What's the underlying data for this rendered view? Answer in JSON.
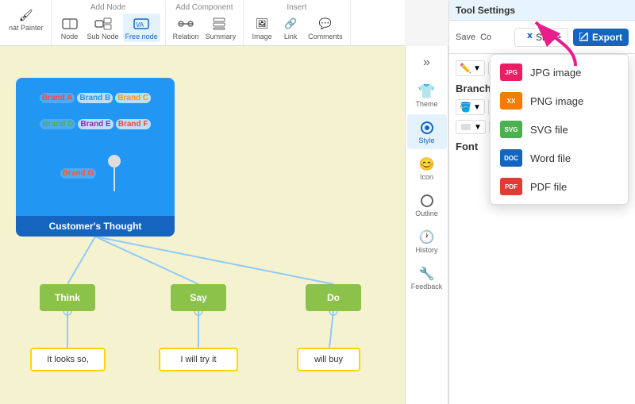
{
  "toolbar": {
    "title": "Tool Settings",
    "groups": [
      {
        "label": "nat Painter",
        "items": [
          {
            "icon": "🖌️",
            "label": "nat Painter"
          }
        ]
      },
      {
        "label": "Add Node",
        "items": [
          {
            "icon": "node",
            "label": "Node"
          },
          {
            "icon": "subnode",
            "label": "Sub Node"
          },
          {
            "icon": "freenode",
            "label": "Free node",
            "active": true
          }
        ]
      },
      {
        "label": "Add Component",
        "items": [
          {
            "icon": "relation",
            "label": "Relation"
          },
          {
            "icon": "summary",
            "label": "Summary"
          }
        ]
      },
      {
        "label": "Insert",
        "items": [
          {
            "icon": "image",
            "label": "Image"
          },
          {
            "icon": "link",
            "label": "Link"
          },
          {
            "icon": "comments",
            "label": "Comments"
          }
        ]
      }
    ],
    "save_label": "Save",
    "co_label": "Co"
  },
  "panel": {
    "title": "Tool Settings",
    "share_label": "Share",
    "export_label": "Export"
  },
  "export_menu": {
    "items": [
      {
        "id": "jpg",
        "label": "JPG image",
        "bg": "#e91e63",
        "abbr": "JPG"
      },
      {
        "id": "png",
        "label": "PNG image",
        "bg": "#f57c00",
        "abbr": "XX"
      },
      {
        "id": "svg",
        "label": "SVG file",
        "bg": "#4caf50",
        "abbr": "SVG"
      },
      {
        "id": "word",
        "label": "Word file",
        "bg": "#1565c0",
        "abbr": "DOC"
      },
      {
        "id": "pdf",
        "label": "PDF file",
        "bg": "#e53935",
        "abbr": "PDF"
      }
    ]
  },
  "side_icons": [
    {
      "id": "chevron",
      "label": "»",
      "isChevron": true
    },
    {
      "id": "theme",
      "label": "Theme"
    },
    {
      "id": "style",
      "label": "Style",
      "active": true
    },
    {
      "id": "icon",
      "label": "Icon"
    },
    {
      "id": "outline",
      "label": "Outline"
    },
    {
      "id": "history",
      "label": "History"
    },
    {
      "id": "feedback",
      "label": "Feedback"
    }
  ],
  "mindmap": {
    "main_title": "Customer's Thought",
    "brands": [
      "Brand A",
      "Brand B",
      "Brand C",
      "Brand D",
      "Brand E",
      "Brand F",
      "Brand G"
    ],
    "nodes": [
      {
        "id": "think",
        "label": "Think"
      },
      {
        "id": "say",
        "label": "Say"
      },
      {
        "id": "do",
        "label": "Do"
      }
    ],
    "subnodes": [
      {
        "id": "think_sub",
        "label": "It looks so,"
      },
      {
        "id": "say_sub",
        "label": "I will try it"
      },
      {
        "id": "do_sub",
        "label": "will buy"
      }
    ]
  },
  "panel_content": {
    "branch_label": "Branch",
    "font_label": "Font"
  }
}
